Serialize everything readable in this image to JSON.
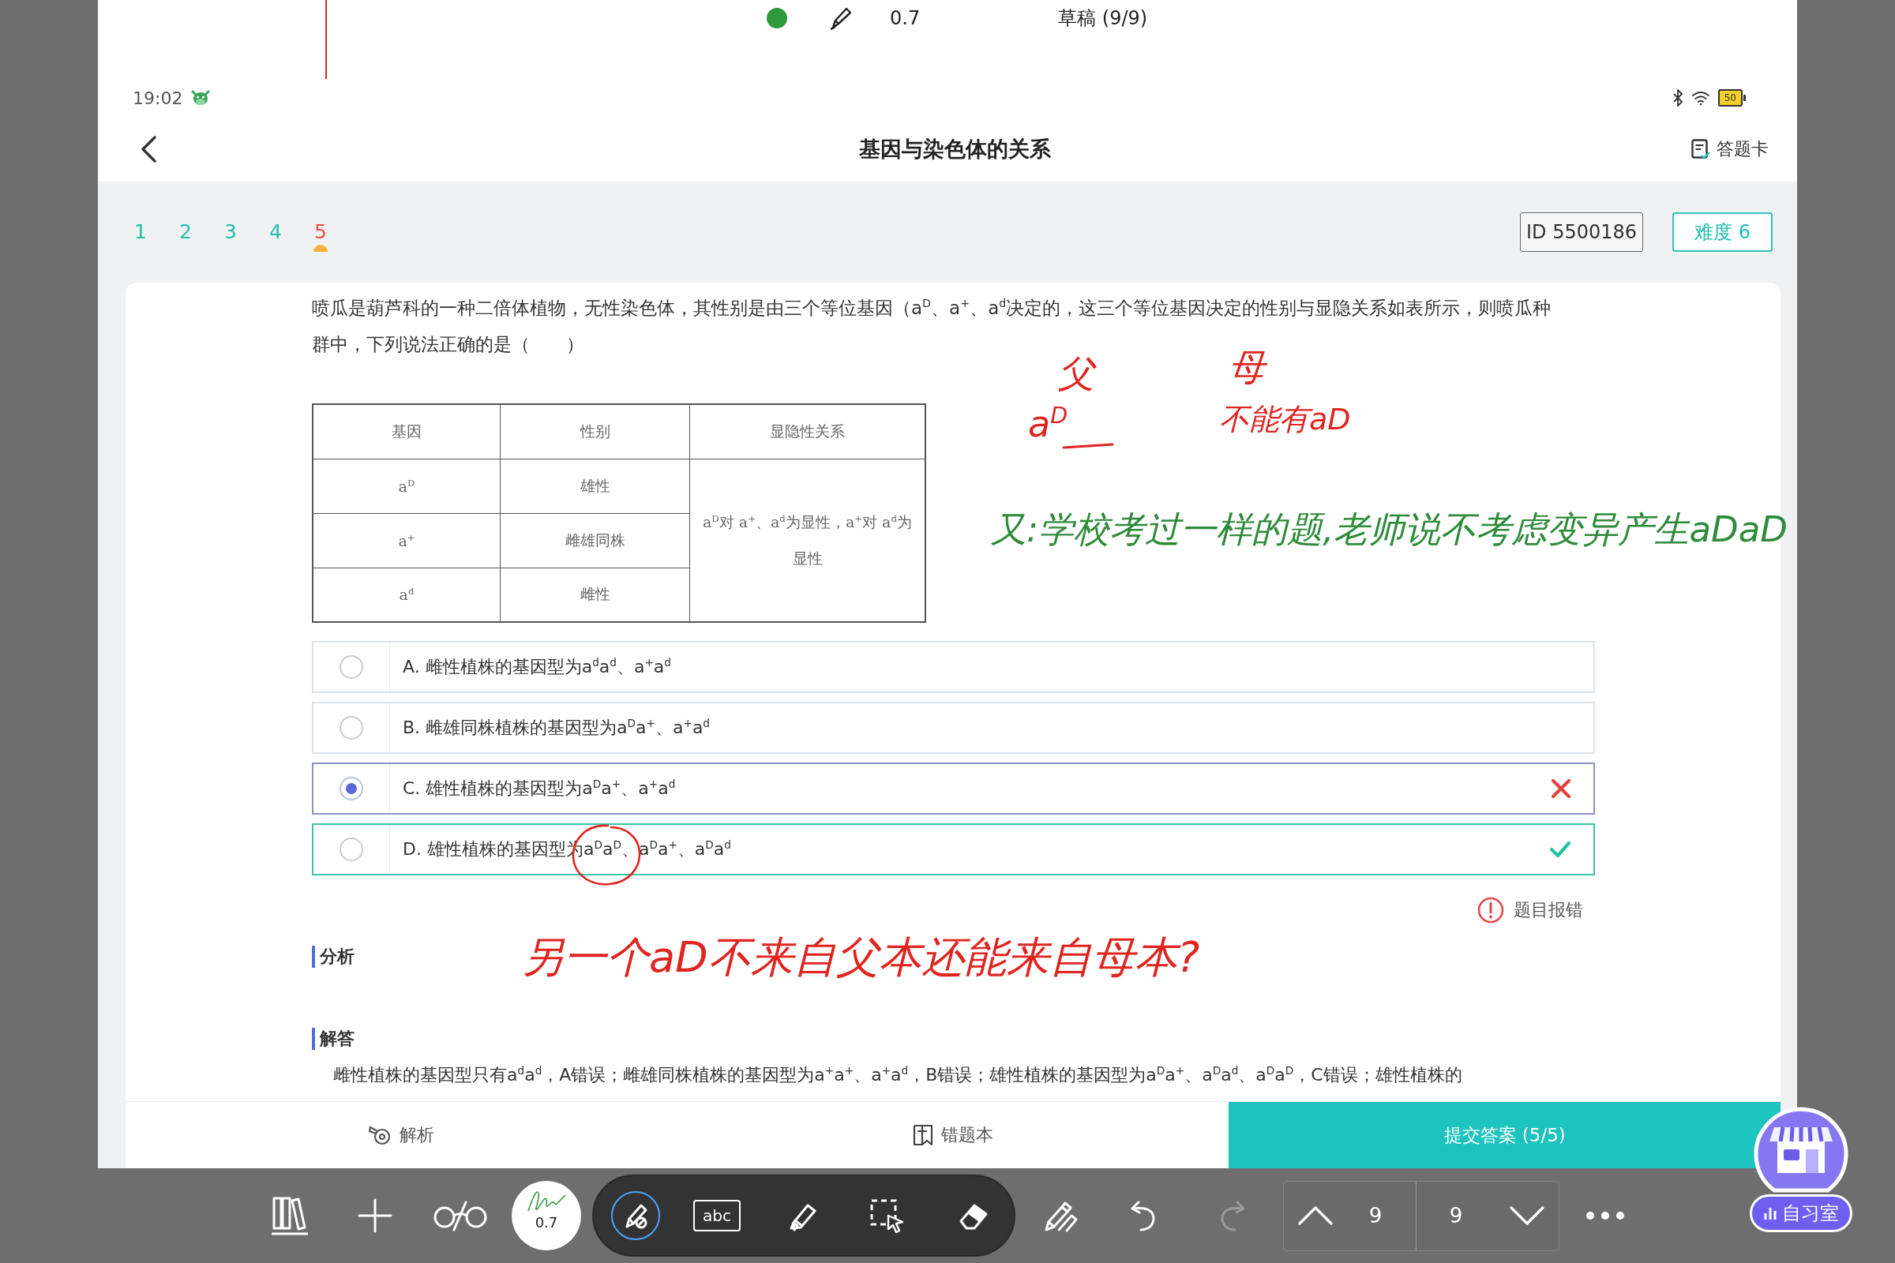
{
  "draft_bar": {
    "pen_size": "0.7",
    "page": "草稿 (9/9)"
  },
  "status_bar": {
    "time": "19:02",
    "battery": "50"
  },
  "nav": {
    "title": "基因与染色体的关系",
    "answer_card": "答题卡"
  },
  "question_nav": {
    "items": [
      {
        "label": "1",
        "selected": false
      },
      {
        "label": "2",
        "selected": false
      },
      {
        "label": "3",
        "selected": false
      },
      {
        "label": "4",
        "selected": false
      },
      {
        "label": "5",
        "selected": true
      }
    ],
    "id": "ID 5500186",
    "difficulty": "难度 6"
  },
  "question": {
    "text": "喷瓜是葫芦科的一种二倍体植物，无性染色体，其性别是由三个等位基因（a$^{D}$、a$^{+}$、a$^{d}$决定的，这三个等位基因决定的性别与显隐关系如表所示，则喷瓜种群中，下列说法正确的是（　　）"
  },
  "table": {
    "columns": [
      "基因",
      "性别",
      "显隐性关系"
    ],
    "rows": [
      {
        "gene": "a$^{D}$",
        "sex": "雄性"
      },
      {
        "gene": "a$^{+}$",
        "sex": "雌雄同株"
      },
      {
        "gene": "a$^{d}$",
        "sex": "雌性"
      }
    ],
    "relation": "a$^{D}$对 a$^{+}$、a$^{d}$为显性，a$^{+}$对 a$^{d}$为显性"
  },
  "options": [
    {
      "text": "A. 雌性植株的基因型为a$^{d}$a$^{d}$、a$^{+}$a$^{d}$",
      "selected": false,
      "correct": false
    },
    {
      "text": "B. 雌雄同株植株的基因型为a$^{D}$a$^{+}$、a$^{+}$a$^{d}$",
      "selected": false,
      "correct": false
    },
    {
      "text": "C. 雄性植株的基因型为a$^{D}$a$^{+}$、a$^{+}$a$^{d}$",
      "selected": true,
      "correct": false
    },
    {
      "text": "D. 雄性植株的基因型为a$^{D}$a$^{D}$、a$^{D}$a$^{+}$、a$^{D}$a$^{d}$",
      "selected": false,
      "correct": true
    }
  ],
  "report_error": "题目报错",
  "analysis": {
    "heading": "分析"
  },
  "solution": {
    "heading": "解答",
    "text": "雌性植株的基因型只有a$^{d}$a$^{d}$，A错误；雌雄同株植株的基因型为a$^{+}$a$^{+}$、a$^{+}$a$^{d}$，B错误；雄性植株的基因型为a$^{D}$a$^{+}$、a$^{D}$a$^{d}$、a$^{D}$a$^{D}$，C错误；雄性植株的"
  },
  "actions": [
    {
      "kind": "analysis",
      "label": "解析"
    },
    {
      "kind": "mistakes",
      "label": "错题本"
    },
    {
      "kind": "submit",
      "label": "提交答案 (5/5)"
    }
  ],
  "toolbar": {
    "pen_size": "0.7",
    "tools": [
      {
        "kind": "pen",
        "selected": true
      },
      {
        "kind": "text",
        "label": "abc",
        "selected": false
      },
      {
        "kind": "highlighter",
        "selected": false
      },
      {
        "kind": "lasso",
        "selected": false
      },
      {
        "kind": "eraser",
        "selected": false
      }
    ],
    "history": [
      {
        "kind": "undo",
        "disabled": false
      },
      {
        "kind": "redo",
        "disabled": true
      }
    ],
    "page_number": "9",
    "page_total": "9",
    "study_room": "自习室"
  },
  "ink_notes": [
    {
      "text": "父",
      "color": "#e0241f"
    },
    {
      "text": "a$^{D}$",
      "color": "#e0241f"
    },
    {
      "text": "母",
      "color": "#e0241f"
    },
    {
      "text": "不能有aD",
      "color": "#e0241f"
    },
    {
      "text": "又:学校考过一样的题,老师说不考虑变异产生aDaD",
      "color": "#2e8b3a"
    },
    {
      "text": "另一个aD不来自父本还能来自母本?",
      "color": "#e0241f"
    }
  ]
}
